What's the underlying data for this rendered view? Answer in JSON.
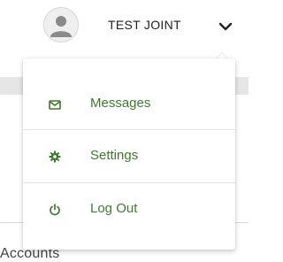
{
  "header": {
    "user_name": "TEST JOINT",
    "avatar_icon": "user-avatar-icon",
    "toggle_icon": "chevron-down-icon"
  },
  "menu": {
    "items": [
      {
        "label": "Messages",
        "icon": "envelope-icon"
      },
      {
        "label": "Settings",
        "icon": "gear-icon"
      },
      {
        "label": "Log Out",
        "icon": "power-icon"
      }
    ]
  },
  "background": {
    "partial_text": "Accounts"
  },
  "colors": {
    "accent": "#3e7a2e",
    "text": "#222222"
  }
}
